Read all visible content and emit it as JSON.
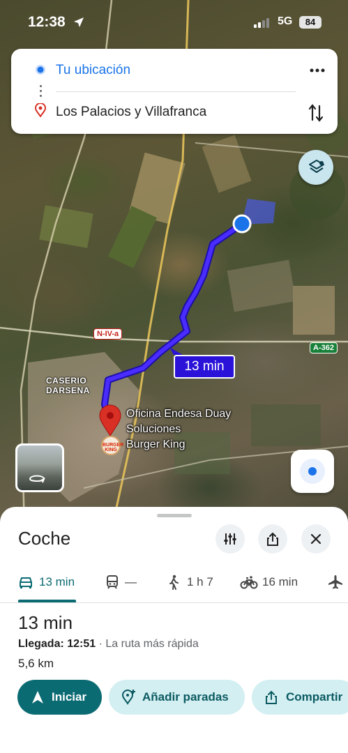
{
  "status_bar": {
    "time": "12:38",
    "network": "5G",
    "battery": "84"
  },
  "directions": {
    "origin": "Tu ubicación",
    "destination": "Los Palacios y Villafranca"
  },
  "map": {
    "road_labels": [
      "N-IV-a",
      "A-362"
    ],
    "place_label": "CASERIO\nDARSENA",
    "route_eta": "13 min",
    "destination_pois": [
      "Oficina Endesa Duay",
      "Soluciones",
      "Burger King"
    ],
    "poi_logo_text": "BURGER KING",
    "route_color": "#3b1fe6"
  },
  "sheet": {
    "title": "Coche",
    "modes": [
      {
        "icon": "car-icon",
        "label": "13 min",
        "active": true
      },
      {
        "icon": "transit-icon",
        "label": "—",
        "active": false
      },
      {
        "icon": "walk-icon",
        "label": "1 h 7",
        "active": false
      },
      {
        "icon": "bike-icon",
        "label": "16 min",
        "active": false
      },
      {
        "icon": "flight-icon",
        "label": "",
        "active": false
      }
    ],
    "summary": {
      "duration": "13 min",
      "arrival_label": "Llegada: 12:51",
      "arrival_note": " · La ruta más rápida",
      "distance": "5,6 km"
    },
    "actions": {
      "start": "Iniciar",
      "add_stops": "Añadir paradas",
      "share": "Compartir"
    },
    "accent_color": "#0b6b73"
  }
}
